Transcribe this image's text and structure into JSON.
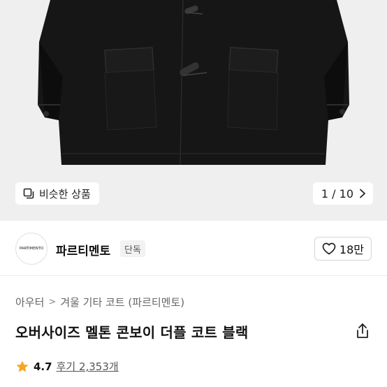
{
  "gallery": {
    "similar_label": "비슷한 상품",
    "pager": "1 / 10"
  },
  "seller": {
    "logo_text": "PARTIMENTO",
    "name": "파르티멘토",
    "badge": "단독",
    "like_count": "18만"
  },
  "breadcrumb": {
    "items": [
      "아우터",
      "겨울 기타 코트 (파르티멘토)"
    ]
  },
  "product": {
    "title": "오버사이즈 멜톤 콘보이 더플 코트 블랙",
    "rating": "4.7",
    "reviews": "후기 2,353개"
  },
  "colors": {
    "accent_star": "#f5a623",
    "coat": "#1a1a1a"
  },
  "icons": {
    "similar": "similar-items-icon",
    "pager": "chevron-right-icon",
    "like": "heart-icon",
    "share": "share-icon",
    "star": "star-icon"
  }
}
